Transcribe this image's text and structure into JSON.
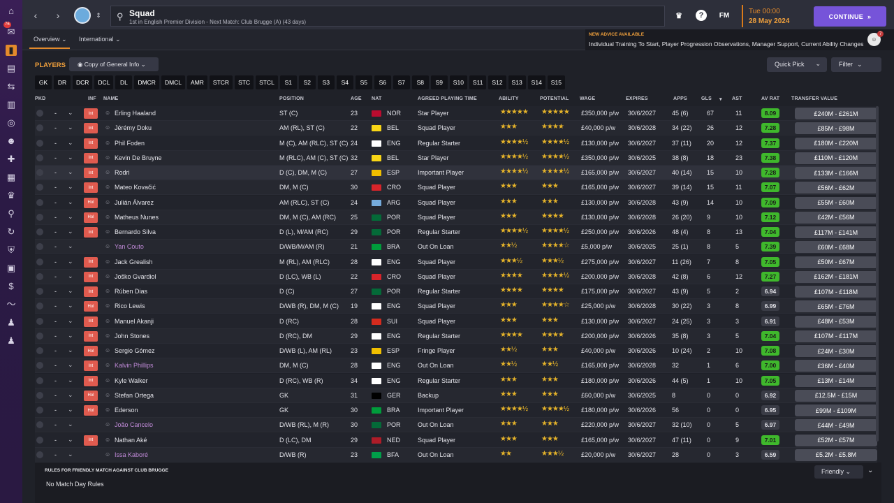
{
  "nav": {
    "badge": "76"
  },
  "topbar": {
    "title": "Squad",
    "subtitle": "1st in English Premier Division - Next Match: Club Brugge (A) (43 days)",
    "fm_label": "FM",
    "date_day": "Tue 00:00",
    "date_full": "28 May 2024",
    "continue_label": "CONTINUE"
  },
  "subnav": {
    "tabs": [
      "Overview",
      "International"
    ],
    "advice_title": "NEW ADVICE AVAILABLE",
    "advice_text": "Individual Training To Start, Player Progression Observations, Manager Support, Current Ability Changes",
    "advice_count": "7"
  },
  "toolbar": {
    "players_label": "PLAYERS",
    "view_label": "Copy of General Info",
    "quick_pick": "Quick Pick",
    "filter": "Filter"
  },
  "slots": [
    "GK",
    "DR",
    "DCR",
    "DCL",
    "DL",
    "DMCR",
    "DMCL",
    "AMR",
    "STCR",
    "STC",
    "STCL",
    "S1",
    "S2",
    "S3",
    "S4",
    "S5",
    "S6",
    "S7",
    "S8",
    "S9",
    "S10",
    "S11",
    "S12",
    "S13",
    "S14",
    "S15"
  ],
  "columns": {
    "pkd": "PKD",
    "inf": "INF",
    "name": "NAME",
    "position": "POSITION",
    "age": "AGE",
    "nat": "NAT",
    "playing_time": "AGREED PLAYING TIME",
    "ability": "ABILITY",
    "potential": "POTENTIAL",
    "wage": "WAGE",
    "expires": "EXPIRES",
    "apps": "APPS",
    "gls": "GLS",
    "ast": "AST",
    "av_rat": "AV RAT",
    "transfer_value": "TRANSFER VALUE"
  },
  "players": [
    {
      "inf": "Int",
      "name": "Erling Haaland",
      "position": "ST (C)",
      "age": "23",
      "nat": "NOR",
      "flag": "#ba0c2f",
      "role": "Star Player",
      "ability": "★★★★★",
      "potential": "★★★★★",
      "wage": "£350,000 p/w",
      "expires": "30/6/2027",
      "apps": "45 (6)",
      "gls": "67",
      "ast": "11",
      "rating": "8.09",
      "rating_color": "#3fb82c",
      "value": "£240M - £261M"
    },
    {
      "inf": "Int",
      "name": "Jérémy Doku",
      "position": "AM (RL), ST (C)",
      "age": "22",
      "nat": "BEL",
      "flag": "#f9d616",
      "role": "Squad Player",
      "ability": "★★★",
      "potential": "★★★★",
      "wage": "£40,000 p/w",
      "expires": "30/6/2028",
      "apps": "34 (22)",
      "gls": "26",
      "ast": "12",
      "rating": "7.28",
      "rating_color": "#3fb82c",
      "value": "£85M - £98M"
    },
    {
      "inf": "Int",
      "name": "Phil Foden",
      "position": "M (C), AM (RLC), ST (C)",
      "age": "24",
      "nat": "ENG",
      "flag": "#ffffff",
      "role": "Regular Starter",
      "ability": "★★★★½",
      "potential": "★★★★½",
      "wage": "£130,000 p/w",
      "expires": "30/6/2027",
      "apps": "37 (11)",
      "gls": "20",
      "ast": "12",
      "rating": "7.37",
      "rating_color": "#3fb82c",
      "value": "£180M - £220M"
    },
    {
      "inf": "Int",
      "name": "Kevin De Bruyne",
      "position": "M (RLC), AM (C), ST (C)",
      "age": "32",
      "nat": "BEL",
      "flag": "#f9d616",
      "role": "Star Player",
      "ability": "★★★★½",
      "potential": "★★★★½",
      "wage": "£350,000 p/w",
      "expires": "30/6/2025",
      "apps": "38 (8)",
      "gls": "18",
      "ast": "23",
      "rating": "7.38",
      "rating_color": "#3fb82c",
      "value": "£110M - £120M"
    },
    {
      "inf": "Int",
      "name": "Rodri",
      "position": "D (C), DM, M (C)",
      "age": "27",
      "nat": "ESP",
      "flag": "#f1bf00",
      "role": "Important Player",
      "ability": "★★★★½",
      "potential": "★★★★½",
      "wage": "£165,000 p/w",
      "expires": "30/6/2027",
      "apps": "40 (14)",
      "gls": "15",
      "ast": "10",
      "rating": "7.28",
      "rating_color": "#3fb82c",
      "value": "£133M - £166M"
    },
    {
      "inf": "Int",
      "name": "Mateo Kovačić",
      "position": "DM, M (C)",
      "age": "30",
      "nat": "CRO",
      "flag": "#d7242a",
      "role": "Squad Player",
      "ability": "★★★",
      "potential": "★★★",
      "wage": "£165,000 p/w",
      "expires": "30/6/2027",
      "apps": "39 (14)",
      "gls": "15",
      "ast": "11",
      "rating": "7.07",
      "rating_color": "#3fb82c",
      "value": "£56M - £62M"
    },
    {
      "inf": "Hol",
      "name": "Julián Álvarez",
      "position": "AM (RLC), ST (C)",
      "age": "24",
      "nat": "ARG",
      "flag": "#75aadb",
      "role": "Squad Player",
      "ability": "★★★",
      "potential": "★★★",
      "wage": "£130,000 p/w",
      "expires": "30/6/2028",
      "apps": "43 (9)",
      "gls": "14",
      "ast": "10",
      "rating": "7.09",
      "rating_color": "#3fb82c",
      "value": "£55M - £60M"
    },
    {
      "inf": "Hol",
      "name": "Matheus Nunes",
      "position": "DM, M (C), AM (RC)",
      "age": "25",
      "nat": "POR",
      "flag": "#046a38",
      "role": "Squad Player",
      "ability": "★★★",
      "potential": "★★★★",
      "wage": "£130,000 p/w",
      "expires": "30/6/2028",
      "apps": "26 (20)",
      "gls": "9",
      "ast": "10",
      "rating": "7.12",
      "rating_color": "#3fb82c",
      "value": "£42M - £56M"
    },
    {
      "inf": "Int",
      "name": "Bernardo Silva",
      "position": "D (L), M/AM (RC)",
      "age": "29",
      "nat": "POR",
      "flag": "#046a38",
      "role": "Regular Starter",
      "ability": "★★★★½",
      "potential": "★★★★½",
      "wage": "£250,000 p/w",
      "expires": "30/6/2026",
      "apps": "48 (4)",
      "gls": "8",
      "ast": "13",
      "rating": "7.04",
      "rating_color": "#3fb82c",
      "value": "£117M - £141M"
    },
    {
      "inf": "",
      "name": "Yan Couto",
      "loan": true,
      "position": "D/WB/M/AM (R)",
      "age": "21",
      "nat": "BRA",
      "flag": "#009c3b",
      "role": "Out On Loan",
      "ability": "★★½",
      "potential": "★★★★☆",
      "wage": "£5,000 p/w",
      "expires": "30/6/2025",
      "apps": "25 (1)",
      "gls": "8",
      "ast": "5",
      "rating": "7.39",
      "rating_color": "#3fb82c",
      "value": "£60M - £68M"
    },
    {
      "inf": "Int",
      "name": "Jack Grealish",
      "position": "M (RL), AM (RLC)",
      "age": "28",
      "nat": "ENG",
      "flag": "#ffffff",
      "role": "Squad Player",
      "ability": "★★★½",
      "potential": "★★★½",
      "wage": "£275,000 p/w",
      "expires": "30/6/2027",
      "apps": "11 (26)",
      "gls": "7",
      "ast": "8",
      "rating": "7.05",
      "rating_color": "#3fb82c",
      "value": "£50M - £67M"
    },
    {
      "inf": "Int",
      "name": "Joško Gvardiol",
      "position": "D (LC), WB (L)",
      "age": "22",
      "nat": "CRO",
      "flag": "#d7242a",
      "role": "Squad Player",
      "ability": "★★★★",
      "potential": "★★★★½",
      "wage": "£200,000 p/w",
      "expires": "30/6/2028",
      "apps": "42 (8)",
      "gls": "6",
      "ast": "12",
      "rating": "7.27",
      "rating_color": "#3fb82c",
      "value": "£162M - £181M"
    },
    {
      "inf": "Int",
      "name": "Rúben Dias",
      "position": "D (C)",
      "age": "27",
      "nat": "POR",
      "flag": "#046a38",
      "role": "Regular Starter",
      "ability": "★★★★",
      "potential": "★★★★",
      "wage": "£175,000 p/w",
      "expires": "30/6/2027",
      "apps": "43 (9)",
      "gls": "5",
      "ast": "2",
      "rating": "6.94",
      "rating_color": "#3a3c46",
      "value": "£107M - £118M"
    },
    {
      "inf": "Hol",
      "name": "Rico Lewis",
      "position": "D/WB (R), DM, M (C)",
      "age": "19",
      "nat": "ENG",
      "flag": "#ffffff",
      "role": "Squad Player",
      "ability": "★★★",
      "potential": "★★★★☆",
      "wage": "£25,000 p/w",
      "expires": "30/6/2028",
      "apps": "30 (22)",
      "gls": "3",
      "ast": "8",
      "rating": "6.99",
      "rating_color": "#3a3c46",
      "value": "£65M - £76M"
    },
    {
      "inf": "Int",
      "name": "Manuel Akanji",
      "position": "D (RC)",
      "age": "28",
      "nat": "SUI",
      "flag": "#d52b1e",
      "role": "Squad Player",
      "ability": "★★★",
      "potential": "★★★",
      "wage": "£130,000 p/w",
      "expires": "30/6/2027",
      "apps": "24 (25)",
      "gls": "3",
      "ast": "3",
      "rating": "6.91",
      "rating_color": "#3a3c46",
      "value": "£48M - £53M"
    },
    {
      "inf": "Int",
      "name": "John Stones",
      "position": "D (RC), DM",
      "age": "29",
      "nat": "ENG",
      "flag": "#ffffff",
      "role": "Regular Starter",
      "ability": "★★★★",
      "potential": "★★★★",
      "wage": "£200,000 p/w",
      "expires": "30/6/2026",
      "apps": "35 (8)",
      "gls": "3",
      "ast": "5",
      "rating": "7.04",
      "rating_color": "#3fb82c",
      "value": "£107M - £117M"
    },
    {
      "inf": "Hol",
      "name": "Sergio Gómez",
      "position": "D/WB (L), AM (RL)",
      "age": "23",
      "nat": "ESP",
      "flag": "#f1bf00",
      "role": "Fringe Player",
      "ability": "★★½",
      "potential": "★★★",
      "wage": "£40,000 p/w",
      "expires": "30/6/2026",
      "apps": "10 (24)",
      "gls": "2",
      "ast": "10",
      "rating": "7.08",
      "rating_color": "#3fb82c",
      "value": "£24M - £30M"
    },
    {
      "inf": "Int",
      "name": "Kalvin Phillips",
      "loan": true,
      "position": "DM, M (C)",
      "age": "28",
      "nat": "ENG",
      "flag": "#ffffff",
      "role": "Out On Loan",
      "ability": "★★½",
      "potential": "★★½",
      "wage": "£165,000 p/w",
      "expires": "30/6/2028",
      "apps": "32",
      "gls": "1",
      "ast": "6",
      "rating": "7.00",
      "rating_color": "#3fb82c",
      "value": "£36M - £40M"
    },
    {
      "inf": "Int",
      "name": "Kyle Walker",
      "position": "D (RC), WB (R)",
      "age": "34",
      "nat": "ENG",
      "flag": "#ffffff",
      "role": "Regular Starter",
      "ability": "★★★",
      "potential": "★★★",
      "wage": "£180,000 p/w",
      "expires": "30/6/2026",
      "apps": "44 (5)",
      "gls": "1",
      "ast": "10",
      "rating": "7.05",
      "rating_color": "#3fb82c",
      "value": "£13M - £14M"
    },
    {
      "inf": "Hol",
      "name": "Stefan Ortega",
      "position": "GK",
      "age": "31",
      "nat": "GER",
      "flag": "#000000",
      "role": "Backup",
      "ability": "★★★",
      "potential": "★★★",
      "wage": "£60,000 p/w",
      "expires": "30/6/2025",
      "apps": "8",
      "gls": "0",
      "ast": "0",
      "rating": "6.92",
      "rating_color": "#3a3c46",
      "value": "£12.5M - £15M"
    },
    {
      "inf": "Hol",
      "name": "Ederson",
      "position": "GK",
      "age": "30",
      "nat": "BRA",
      "flag": "#009c3b",
      "role": "Important Player",
      "ability": "★★★★½",
      "potential": "★★★★½",
      "wage": "£180,000 p/w",
      "expires": "30/6/2026",
      "apps": "56",
      "gls": "0",
      "ast": "0",
      "rating": "6.95",
      "rating_color": "#3a3c46",
      "value": "£99M - £109M"
    },
    {
      "inf": "",
      "name": "João Cancelo",
      "loan": true,
      "position": "D/WB (RL), M (R)",
      "age": "30",
      "nat": "POR",
      "flag": "#046a38",
      "role": "Out On Loan",
      "ability": "★★★",
      "potential": "★★★",
      "wage": "£220,000 p/w",
      "expires": "30/6/2027",
      "apps": "32 (10)",
      "gls": "0",
      "ast": "5",
      "rating": "6.97",
      "rating_color": "#3a3c46",
      "value": "£44M - £49M"
    },
    {
      "inf": "Int",
      "name": "Nathan Aké",
      "position": "D (LC), DM",
      "age": "29",
      "nat": "NED",
      "flag": "#ae1c28",
      "role": "Squad Player",
      "ability": "★★★",
      "potential": "★★★",
      "wage": "£165,000 p/w",
      "expires": "30/6/2027",
      "apps": "47 (11)",
      "gls": "0",
      "ast": "9",
      "rating": "7.01",
      "rating_color": "#3fb82c",
      "value": "£52M - £57M"
    },
    {
      "inf": "",
      "name": "Issa Kaboré",
      "loan": true,
      "position": "D/WB (R)",
      "age": "23",
      "nat": "BFA",
      "flag": "#009e49",
      "role": "Out On Loan",
      "ability": "★★",
      "potential": "★★★½",
      "wage": "£20,000 p/w",
      "expires": "30/6/2027",
      "apps": "28",
      "gls": "0",
      "ast": "3",
      "rating": "6.59",
      "rating_color": "#3a3c46",
      "value": "£5.2M - £5.8M"
    }
  ],
  "bottom": {
    "rules_title": "RULES FOR FRIENDLY MATCH AGAINST CLUB BRUGGE",
    "rules_text": "No Match Day Rules",
    "match_type": "Friendly"
  }
}
